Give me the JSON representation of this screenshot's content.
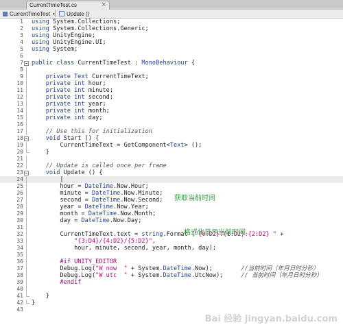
{
  "tab": {
    "title": "CurrentTimeTest.cs",
    "close": "×"
  },
  "navbar": {
    "class_name": "CurrentTimeTest",
    "method_name": "Update ()"
  },
  "editor": {
    "lines": [
      {
        "n": "1",
        "html": "<span class='kw'>using</span> System.Collections;"
      },
      {
        "n": "2",
        "html": "<span class='kw'>using</span> System.Collections.Generic;"
      },
      {
        "n": "3",
        "html": "<span class='kw'>using</span> UnityEngine;"
      },
      {
        "n": "4",
        "html": "<span class='kw'>using</span> UnityEngine.UI;"
      },
      {
        "n": "5",
        "html": "<span class='kw'>using</span> System;"
      },
      {
        "n": "6",
        "html": ""
      },
      {
        "n": "7",
        "html": "<span class='kw'>public class</span> CurrentTimeTest : <span class='ty'>MonoBehaviour</span> {"
      },
      {
        "n": "8",
        "html": ""
      },
      {
        "n": "9",
        "html": "    <span class='kw'>private</span> <span class='ty'>Text</span> CurrentTimeText;"
      },
      {
        "n": "10",
        "html": "    <span class='kw'>private int</span> hour;"
      },
      {
        "n": "11",
        "html": "    <span class='kw'>private int</span> minute;"
      },
      {
        "n": "12",
        "html": "    <span class='kw'>private int</span> second;"
      },
      {
        "n": "13",
        "html": "    <span class='kw'>private int</span> year;"
      },
      {
        "n": "14",
        "html": "    <span class='kw'>private int</span> month;"
      },
      {
        "n": "15",
        "html": "    <span class='kw'>private int</span> day;"
      },
      {
        "n": "16",
        "html": ""
      },
      {
        "n": "17",
        "html": "    <span class='cm'>// Use this for initialization</span>"
      },
      {
        "n": "18",
        "html": "    <span class='kw'>void</span> Start () {"
      },
      {
        "n": "19",
        "html": "        CurrentTimeText = GetComponent&lt;<span class='ty'>Text</span>&gt; ();"
      },
      {
        "n": "20",
        "html": "    }"
      },
      {
        "n": "21",
        "html": ""
      },
      {
        "n": "22",
        "html": "    <span class='cm'>// Update is called once per frame</span>"
      },
      {
        "n": "23",
        "html": "    <span class='kw'>void</span> Update () {"
      },
      {
        "n": "24",
        "html": "        |"
      },
      {
        "n": "25",
        "html": "        hour = <span class='ty'>DateTime</span>.Now.Hour;"
      },
      {
        "n": "26",
        "html": "        minute = <span class='ty'>DateTime</span>.Now.Minute;"
      },
      {
        "n": "27",
        "html": "        second = <span class='ty'>DateTime</span>.Now.Second;"
      },
      {
        "n": "28",
        "html": "        year = <span class='ty'>DateTime</span>.Now.Year;"
      },
      {
        "n": "29",
        "html": "        month = <span class='ty'>DateTime</span>.Now.Month;"
      },
      {
        "n": "30",
        "html": "        day = <span class='ty'>DateTime</span>.Now.Day;"
      },
      {
        "n": "31",
        "html": ""
      },
      {
        "n": "32",
        "html": "        CurrentTimeText.text = <span class='kw'>string</span>.Format (<span class='st'>\"{0:D2}:{1:D2}:{2:D2} \"</span> +"
      },
      {
        "n": "33",
        "html": "            <span class='st'>\"{3:D4}/{4:D2}/{5:D2}\"</span>,"
      },
      {
        "n": "34",
        "html": "            hour, minute, second, year, month, day);"
      },
      {
        "n": "35",
        "html": ""
      },
      {
        "n": "36",
        "html": "        <span class='pp'>#if UNITY_EDITOR</span>"
      },
      {
        "n": "37",
        "html": "        Debug.Log(<span class='st'>\"W now  \"</span> + System.<span class='ty'>DateTime</span>.Now);        <span class='cm'>//当前时间（年月日时分秒）</span>"
      },
      {
        "n": "38",
        "html": "        Debug.Log(<span class='st'>\"W utc  \"</span> + System.<span class='ty'>DateTime</span>.UtcNow);     <span class='cm'>// 当前时间（年月日时分秒）</span>"
      },
      {
        "n": "39",
        "html": "        <span class='pp'>#endif</span>"
      },
      {
        "n": "40",
        "html": ""
      },
      {
        "n": "41",
        "html": "    }"
      },
      {
        "n": "42",
        "html": "}"
      },
      {
        "n": "43",
        "html": ""
      }
    ]
  },
  "annotations": {
    "get_time": "获取当前时间",
    "format_display": "格式化显示当前时间"
  },
  "watermark": "Bai 经验 jingyan.baidu.com"
}
